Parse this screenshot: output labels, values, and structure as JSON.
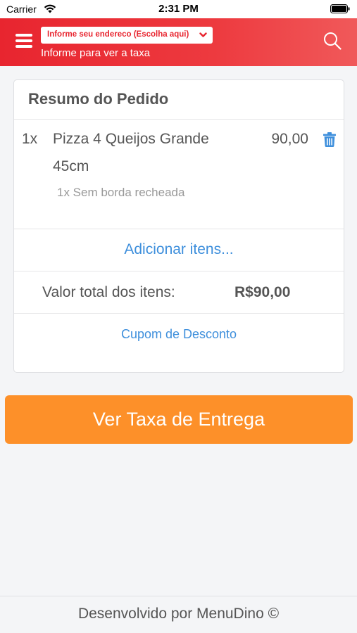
{
  "status_bar": {
    "carrier": "Carrier",
    "time": "2:31 PM"
  },
  "header": {
    "address_select_label": "Informe seu endereco (Escolha aqui)",
    "subtitle": "Informe para ver a taxa",
    "accent_color": "#e8252f"
  },
  "order_summary": {
    "title": "Resumo do Pedido",
    "items": [
      {
        "quantity": "1x",
        "name": "Pizza 4 Queijos Grande 45cm",
        "price": "90,00",
        "option": "1x Sem borda recheada"
      }
    ],
    "add_items_label": "Adicionar itens...",
    "total_label": "Valor total dos itens:",
    "total_value": "R$90,00",
    "coupon_label": "Cupom de Desconto",
    "link_color": "#3e8fdc"
  },
  "primary_button": {
    "label": "Ver Taxa de Entrega",
    "color": "#fd9029"
  },
  "footer": {
    "text": "Desenvolvido por MenuDino ©"
  },
  "icons": {
    "menu": "hamburger-menu-icon",
    "search": "search-icon",
    "trash": "trash-icon",
    "chevron": "chevron-down-icon",
    "wifi": "wifi-icon",
    "battery": "battery-icon"
  }
}
